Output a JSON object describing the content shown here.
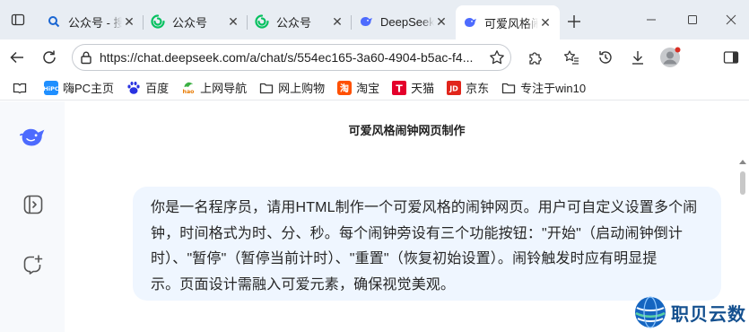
{
  "tabs": [
    {
      "title": "公众号 - 搜",
      "favicon": "search-favicon"
    },
    {
      "title": "公众号",
      "favicon": "wechat-favicon"
    },
    {
      "title": "公众号",
      "favicon": "wechat-favicon"
    },
    {
      "title": "DeepSeek",
      "favicon": "deepseek-favicon"
    },
    {
      "title": "可爱风格闹钟网页制作",
      "favicon": "deepseek-favicon",
      "active": true
    }
  ],
  "address_bar": {
    "url": "https://chat.deepseek.com/a/chat/s/554ec165-3a60-4904-b5ac-f4..."
  },
  "bookmarks": [
    {
      "label": "嗨PC主页",
      "icon": "hipc-icon"
    },
    {
      "label": "百度",
      "icon": "baidu-paw-icon"
    },
    {
      "label": "上网导航",
      "icon": "hao-nav-icon"
    },
    {
      "label": "网上购物",
      "icon": "folder-icon"
    },
    {
      "label": "淘宝",
      "icon": "taobao-icon"
    },
    {
      "label": "天猫",
      "icon": "tmall-icon"
    },
    {
      "label": "京东",
      "icon": "jd-icon"
    },
    {
      "label": "专注于win10",
      "icon": "folder-icon"
    }
  ],
  "chat": {
    "title": "可爱风格闹钟网页制作",
    "user_message_lines": [
      "你是一名程序员，请用HTML制作一个可爱风格的闹钟网页。用户可自定义设置多个闹",
      "钟，时间格式为时、分、秒。每个闹钟旁设有三个功能按钮：\"开始\"（启动闹钟倒计",
      "时）、\"暂停\"（暂停当前计时）、\"重置\"（恢复初始设置）。闹铃触发时应有明显提",
      "示。页面设计需融入可爱元素，确保视觉美观。"
    ]
  },
  "watermark": {
    "text": "职贝云数"
  },
  "colors": {
    "tab_strip_bg": "#e8edf3",
    "deepseek_blue": "#4d6bfe",
    "bubble_bg": "#eff6ff",
    "sidebar_bg": "#f7f9fc",
    "watermark_blue": "#14508f"
  }
}
